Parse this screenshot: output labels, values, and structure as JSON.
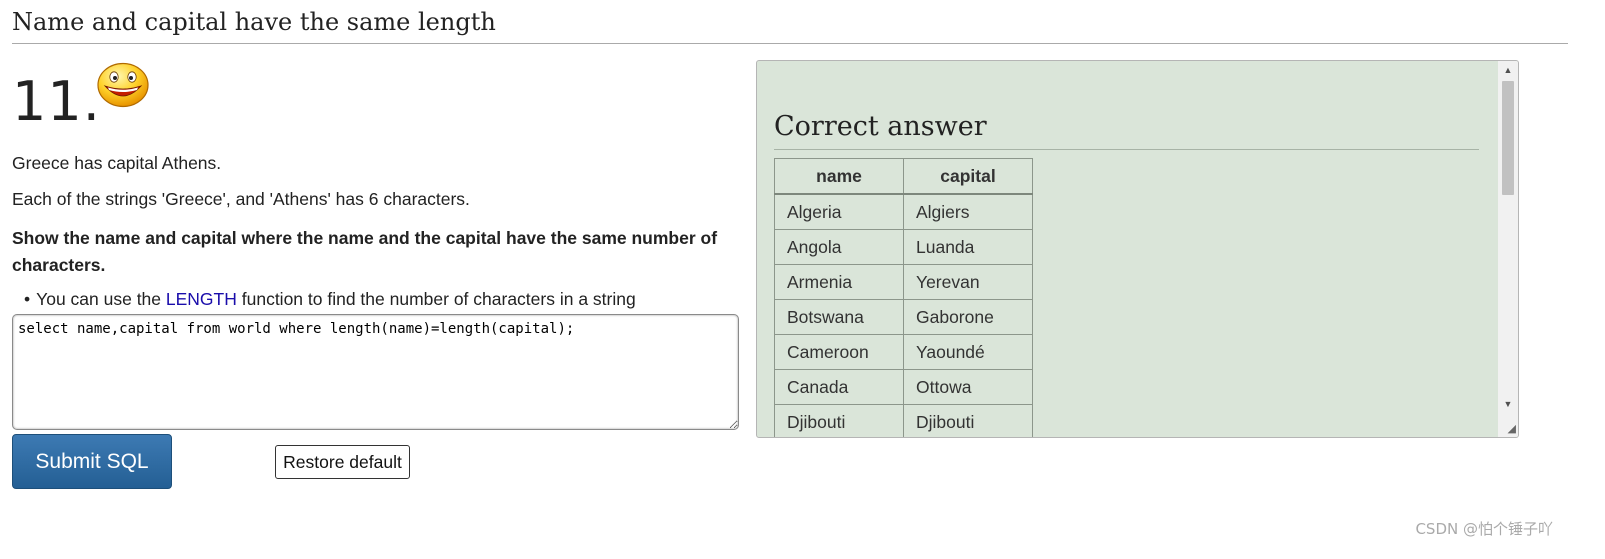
{
  "page": {
    "section_title": "Name and capital have the same length",
    "question_number": "11.",
    "smiley_icon": "grinning-face-icon"
  },
  "question": {
    "paragraph_1": "Greece has capital Athens.",
    "paragraph_2": "Each of the strings 'Greece', and 'Athens' has 6 characters.",
    "instruction": "Show the name and capital where the name and the capital have the same number of characters.",
    "hint_before": "You can use the ",
    "hint_link": "LENGTH",
    "hint_after": " function to find the number of characters in a string"
  },
  "editor": {
    "sql_value": "select name,capital from world where length(name)=length(capital);"
  },
  "buttons": {
    "submit_label": "Submit SQL",
    "restore_label": "Restore default"
  },
  "answer": {
    "heading": "Correct answer",
    "columns": [
      "name",
      "capital"
    ],
    "rows": [
      [
        "Algeria",
        "Algiers"
      ],
      [
        "Angola",
        "Luanda"
      ],
      [
        "Armenia",
        "Yerevan"
      ],
      [
        "Botswana",
        "Gaborone"
      ],
      [
        "Cameroon",
        "Yaoundé"
      ],
      [
        "Canada",
        "Ottowa"
      ],
      [
        "Djibouti",
        "Djibouti"
      ]
    ]
  },
  "watermark": "CSDN @怕个锤子吖",
  "colors": {
    "submit_button": "#2f6ea6",
    "answer_panel_bg": "#dae5d9",
    "link": "#1a0dab"
  }
}
